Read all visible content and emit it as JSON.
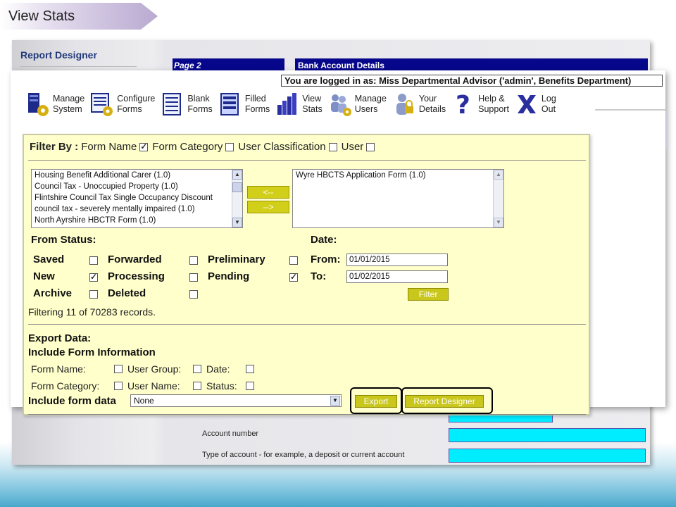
{
  "slide_title": "View Stats",
  "background_window": {
    "title": "Report Designer",
    "page_label": "Page  2",
    "section_title": "Bank Account Details",
    "rows": [
      "Account number",
      "Type of account - for example, a deposit or current account"
    ]
  },
  "header": {
    "logged_in_text": "You are logged in as: Miss Departmental Advisor ('admin', Benefits Department)"
  },
  "toolbar": [
    {
      "label": "Manage\nSystem",
      "icon": "manage-system-icon"
    },
    {
      "label": "Configure\nForms",
      "icon": "configure-forms-icon"
    },
    {
      "label": "Blank\nForms",
      "icon": "blank-forms-icon"
    },
    {
      "label": "Filled\nForms",
      "icon": "filled-forms-icon"
    },
    {
      "label": "View\nStats",
      "icon": "view-stats-icon"
    },
    {
      "label": "Manage\nUsers",
      "icon": "manage-users-icon"
    },
    {
      "label": "Your\nDetails",
      "icon": "your-details-icon"
    },
    {
      "label": "Help &\nSupport",
      "icon": "help-icon"
    },
    {
      "label": "Log\nOut",
      "icon": "logout-icon"
    }
  ],
  "filter": {
    "filter_by_label": "Filter By :",
    "options": [
      {
        "label": "Form Name",
        "checked": true
      },
      {
        "label": "Form Category",
        "checked": false
      },
      {
        "label": "User Classification",
        "checked": false
      },
      {
        "label": "User",
        "checked": false
      }
    ],
    "available_forms": [
      "Housing Benefit Additional Carer (1.0)",
      "Council Tax - Unoccupied Property (1.0)",
      "Flintshire Council Tax Single Occupancy Discount",
      "council tax - severely mentally impaired (1.0)",
      "North Ayrshire HBCTR Form (1.0)"
    ],
    "selected_forms": [
      "Wyre HBCTS Application Form (1.0)"
    ],
    "move_left": "<--",
    "move_right": "-->",
    "from_status_label": "From Status:",
    "date_label": "Date:",
    "statuses": [
      {
        "label": "Saved",
        "checked": false
      },
      {
        "label": "Forwarded",
        "checked": false
      },
      {
        "label": "Preliminary",
        "checked": false
      },
      {
        "label": "New",
        "checked": true
      },
      {
        "label": "Processing",
        "checked": false
      },
      {
        "label": "Pending",
        "checked": true
      },
      {
        "label": "Archive",
        "checked": false
      },
      {
        "label": "Deleted",
        "checked": false
      }
    ],
    "from_label": "From:",
    "from_value": "01/01/2015",
    "to_label": "To:",
    "to_value": "01/02/2015",
    "filter_button": "Filter",
    "records_text": "Filtering 11 of 70283 records."
  },
  "export": {
    "title": "Export Data:",
    "include_form_info": "Include Form Information",
    "fields": [
      {
        "label": "Form Name:",
        "checked": false
      },
      {
        "label": "User Group:",
        "checked": false
      },
      {
        "label": "Date:",
        "checked": false
      },
      {
        "label": "Form Category:",
        "checked": false
      },
      {
        "label": "User Name:",
        "checked": false
      },
      {
        "label": "Status:",
        "checked": false
      }
    ],
    "include_form_data": "Include form data",
    "form_data_value": "None",
    "export_button": "Export",
    "report_designer_button": "Report Designer"
  }
}
